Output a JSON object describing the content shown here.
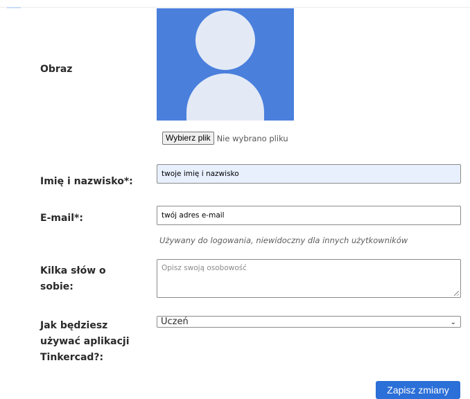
{
  "form": {
    "image_label": "Obraz",
    "file_button_label": "Wybierz plik",
    "file_status": "Nie wybrano pliku",
    "name_label": "Imię i nazwisko*:",
    "name_value": "twoje imię i nazwisko",
    "email_label": "E-mail*:",
    "email_value": "twój adres e-mail",
    "email_hint": "Używany do logowania, niewidoczny dla innych użytkowników",
    "about_label": "Kilka słów o sobie:",
    "about_placeholder": "Opisz swoją osobowość",
    "usage_label": "Jak będziesz używać aplikacji Tinkercad?:",
    "usage_selected": "Uczeń",
    "save_label": "Zapisz zmiany"
  },
  "colors": {
    "avatar_bg": "#4a7fdc",
    "avatar_figure": "#e3eaf6",
    "accent_button": "#2b6fd8",
    "autofill_bg": "#e8f0fe"
  },
  "icons": {
    "avatar": "default-user-avatar-icon",
    "select_chevron": "chevron-down-icon",
    "resize": "resize-grip-icon"
  }
}
